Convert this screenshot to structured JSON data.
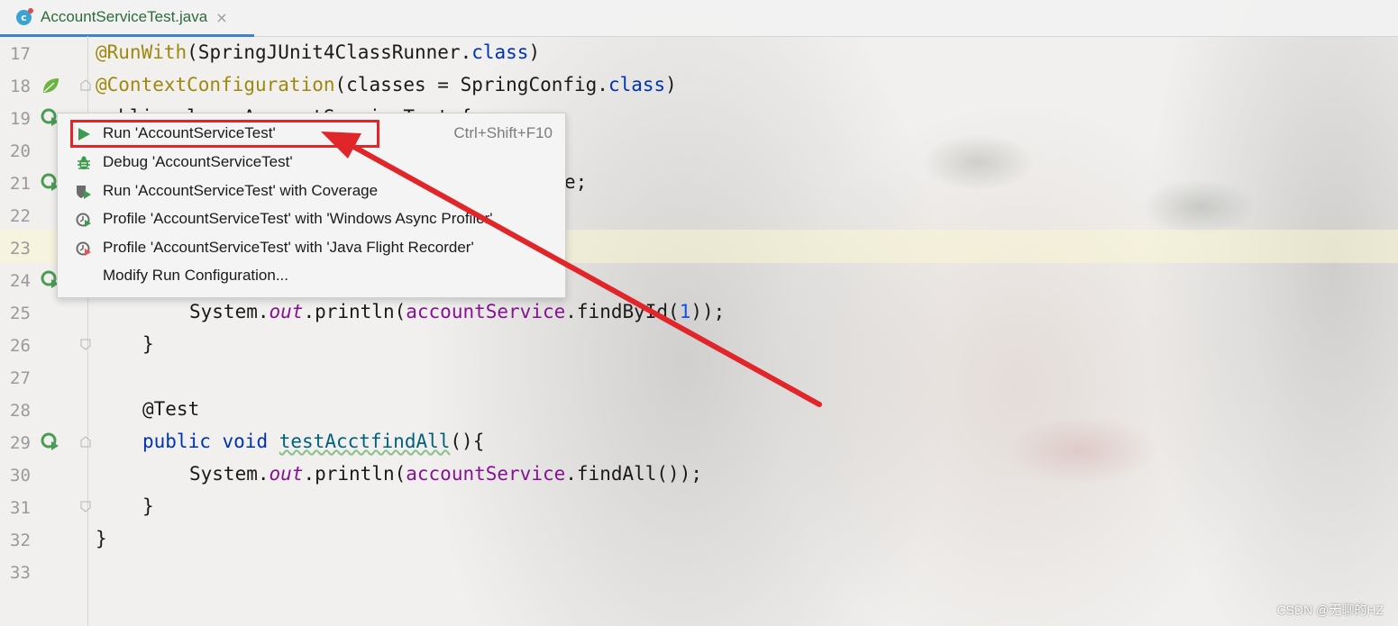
{
  "tab": {
    "icon": "class-c-icon",
    "filename": "AccountServiceTest.java",
    "close": "×"
  },
  "gutter": {
    "line_numbers": [
      "17",
      "18",
      "19",
      "20",
      "21",
      "22",
      "23",
      "24",
      "25",
      "26",
      "27",
      "28",
      "29",
      "30",
      "31",
      "32",
      "33"
    ]
  },
  "code": {
    "l17": {
      "annotation": "@RunWith",
      "rest": "(SpringJUnit4ClassRunner.",
      "kw": "class",
      "end": ")"
    },
    "l18": {
      "annotation": "@ContextConfiguration",
      "rest": "(classes = SpringConfig.",
      "kw": "class",
      "end": ")"
    },
    "l19_visible": "public class AccountServiceTest {",
    "l21_end": "e;",
    "l25": {
      "a": "System.",
      "out": "out",
      "b": ".println(",
      "fld": "accountService",
      "c": ".findById(",
      "num": "1",
      "d": "));"
    },
    "l26": "}",
    "l28": {
      "annotation": "@Test"
    },
    "l29": {
      "kw1": "public",
      "kw2": "void",
      "name": "testAcctfindAll",
      "end": "(){"
    },
    "l30": {
      "a": "System.",
      "out": "out",
      "b": ".println(",
      "fld": "accountService",
      "c": ".findAll());"
    },
    "l31": "}",
    "l32": "}"
  },
  "context_menu": {
    "items": [
      {
        "icon": "run-icon",
        "label": "Run 'AccountServiceTest'",
        "shortcut": "Ctrl+Shift+F10"
      },
      {
        "icon": "debug-icon",
        "label": "Debug 'AccountServiceTest'",
        "shortcut": ""
      },
      {
        "icon": "coverage-icon",
        "label": "Run 'AccountServiceTest' with Coverage",
        "shortcut": ""
      },
      {
        "icon": "profile-icon",
        "label": "Profile 'AccountServiceTest' with 'Windows Async Profiler'",
        "shortcut": ""
      },
      {
        "icon": "profile-flight-icon",
        "label": "Profile 'AccountServiceTest' with 'Java Flight Recorder'",
        "shortcut": ""
      },
      {
        "icon": "",
        "label": "Modify Run Configuration...",
        "shortcut": ""
      }
    ]
  },
  "annotation": {
    "highlight_color": "#e0262b"
  },
  "watermark": "CSDN @无聊的HZ"
}
